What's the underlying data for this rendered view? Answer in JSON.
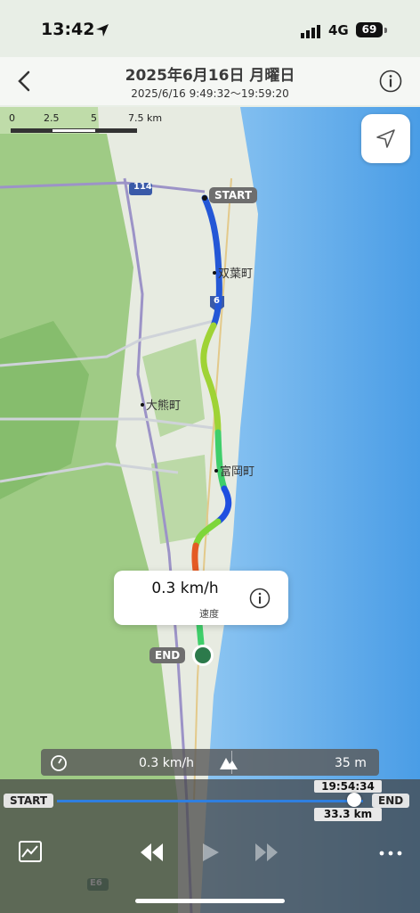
{
  "status": {
    "time": "13:42",
    "network": "4G",
    "battery": "69"
  },
  "header": {
    "title": "2025年6月16日 月曜日",
    "subtitle": "2025/6/16 9:49:32～19:59:20"
  },
  "scale": {
    "labels": [
      "0",
      "2.5",
      "5",
      "7.5 km"
    ]
  },
  "map": {
    "places": [
      "双葉町",
      "大熊町",
      "富岡町"
    ],
    "road_numbers": [
      "114",
      "6",
      "E6"
    ],
    "start_label": "START",
    "end_label": "END"
  },
  "popup": {
    "speed": "0.3 km/h",
    "label": "速度"
  },
  "stats": {
    "speed": "0.3 km/h",
    "elevation": "35 m"
  },
  "timeline": {
    "start_label": "START",
    "end_label": "END",
    "current_time": "19:54:34",
    "distance": "33.3 km",
    "position_fraction": 0.97
  },
  "colors": {
    "accent": "#2f7fe0",
    "sea": "#5aa9ea",
    "land": "#e9ece4",
    "forest": "#b3d49a"
  }
}
